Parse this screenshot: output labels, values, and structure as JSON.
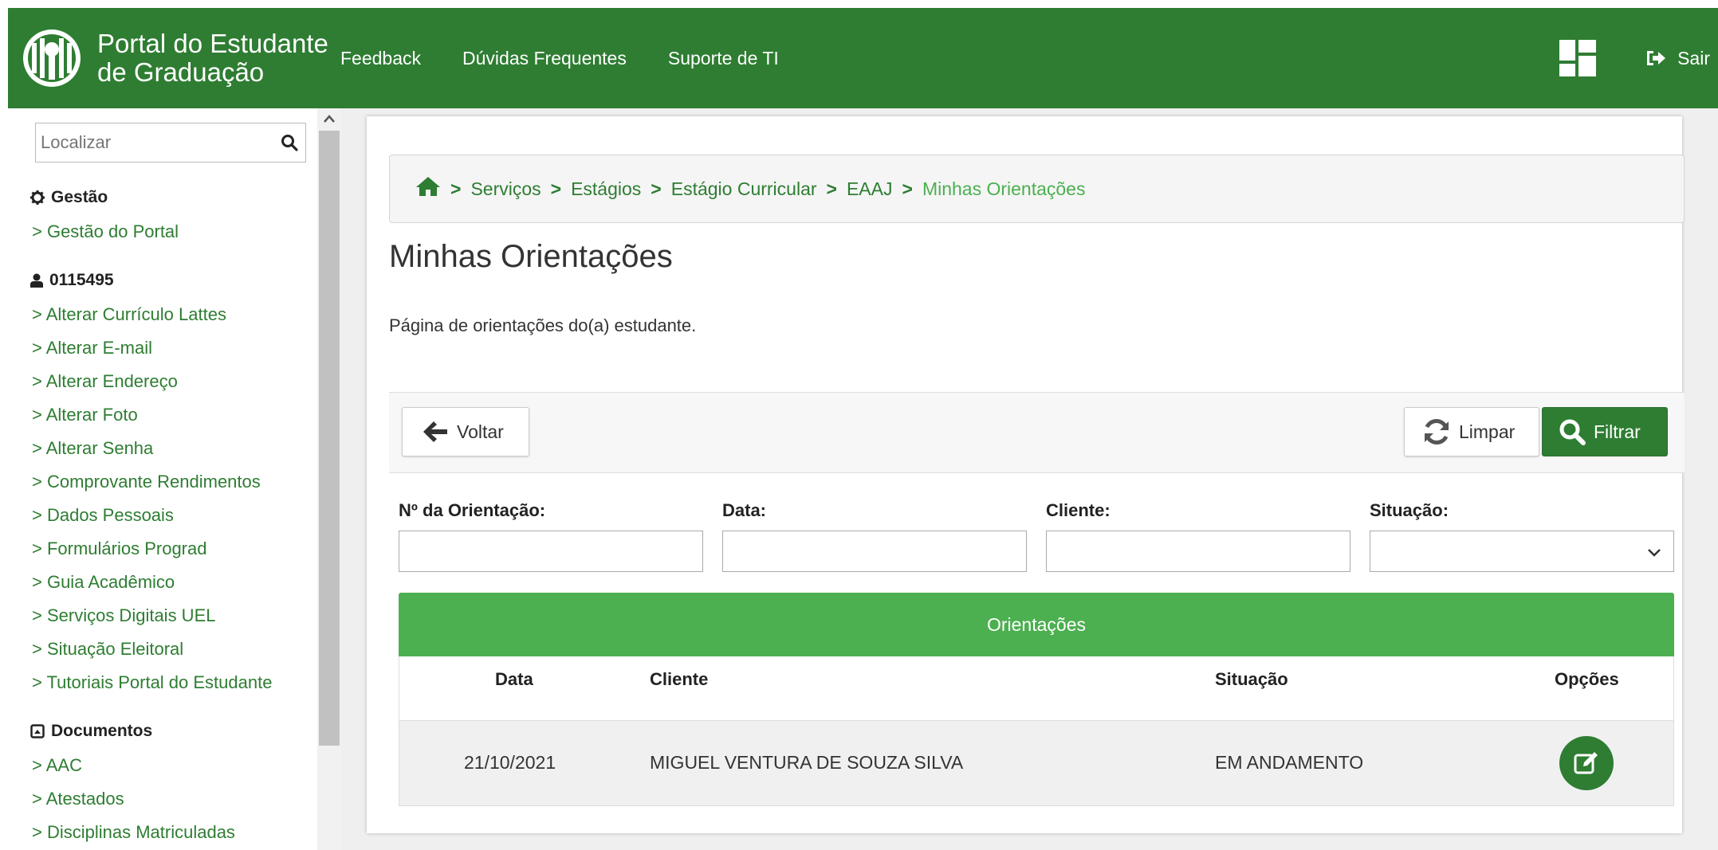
{
  "header": {
    "brand_line1": "Portal do Estudante",
    "brand_line2": "de Graduação",
    "nav": [
      "Feedback",
      "Dúvidas Frequentes",
      "Suporte de TI"
    ],
    "logout_label": "Sair",
    "color": "#2e7d32"
  },
  "sidebar": {
    "search_placeholder": "Localizar",
    "sections": [
      {
        "title": "Gestão",
        "icon": "gear-icon",
        "items": [
          "> Gestão do Portal"
        ]
      },
      {
        "title": "0115495",
        "icon": "user-icon",
        "items": [
          "> Alterar Currículo Lattes",
          "> Alterar E-mail",
          "> Alterar Endereço",
          "> Alterar Foto",
          "> Alterar Senha",
          "> Comprovante Rendimentos",
          "> Dados Pessoais",
          "> Formulários Prograd",
          "> Guia Acadêmico",
          "> Serviços Digitais UEL",
          "> Situação Eleitoral",
          "> Tutoriais Portal do Estudante"
        ]
      },
      {
        "title": "Documentos",
        "icon": "document-icon",
        "items": [
          "> AAC",
          "> Atestados",
          "> Disciplinas Matriculadas"
        ]
      }
    ]
  },
  "breadcrumb": [
    "Serviços",
    "Estágios",
    "Estágio Curricular",
    "EAAJ",
    "Minhas Orientações"
  ],
  "page": {
    "title": "Minhas Orientações",
    "description": "Página de orientações do(a) estudante."
  },
  "toolbar": {
    "back_label": "Voltar",
    "clear_label": "Limpar",
    "filter_label": "Filtrar"
  },
  "filters": {
    "numero_label": "Nº da Orientação:",
    "data_label": "Data:",
    "cliente_label": "Cliente:",
    "situacao_label": "Situação:",
    "numero_value": "",
    "data_value": "",
    "cliente_value": "",
    "situacao_value": ""
  },
  "table": {
    "title": "Orientações",
    "columns": [
      "Data",
      "Cliente",
      "Situação",
      "Opções"
    ],
    "rows": [
      {
        "data": "21/10/2021",
        "cliente": "MIGUEL VENTURA DE SOUZA SILVA",
        "situacao": "EM ANDAMENTO"
      }
    ]
  },
  "colors": {
    "primary": "#2e7d32",
    "table_header": "#4caf50",
    "link": "#2e7d32"
  }
}
